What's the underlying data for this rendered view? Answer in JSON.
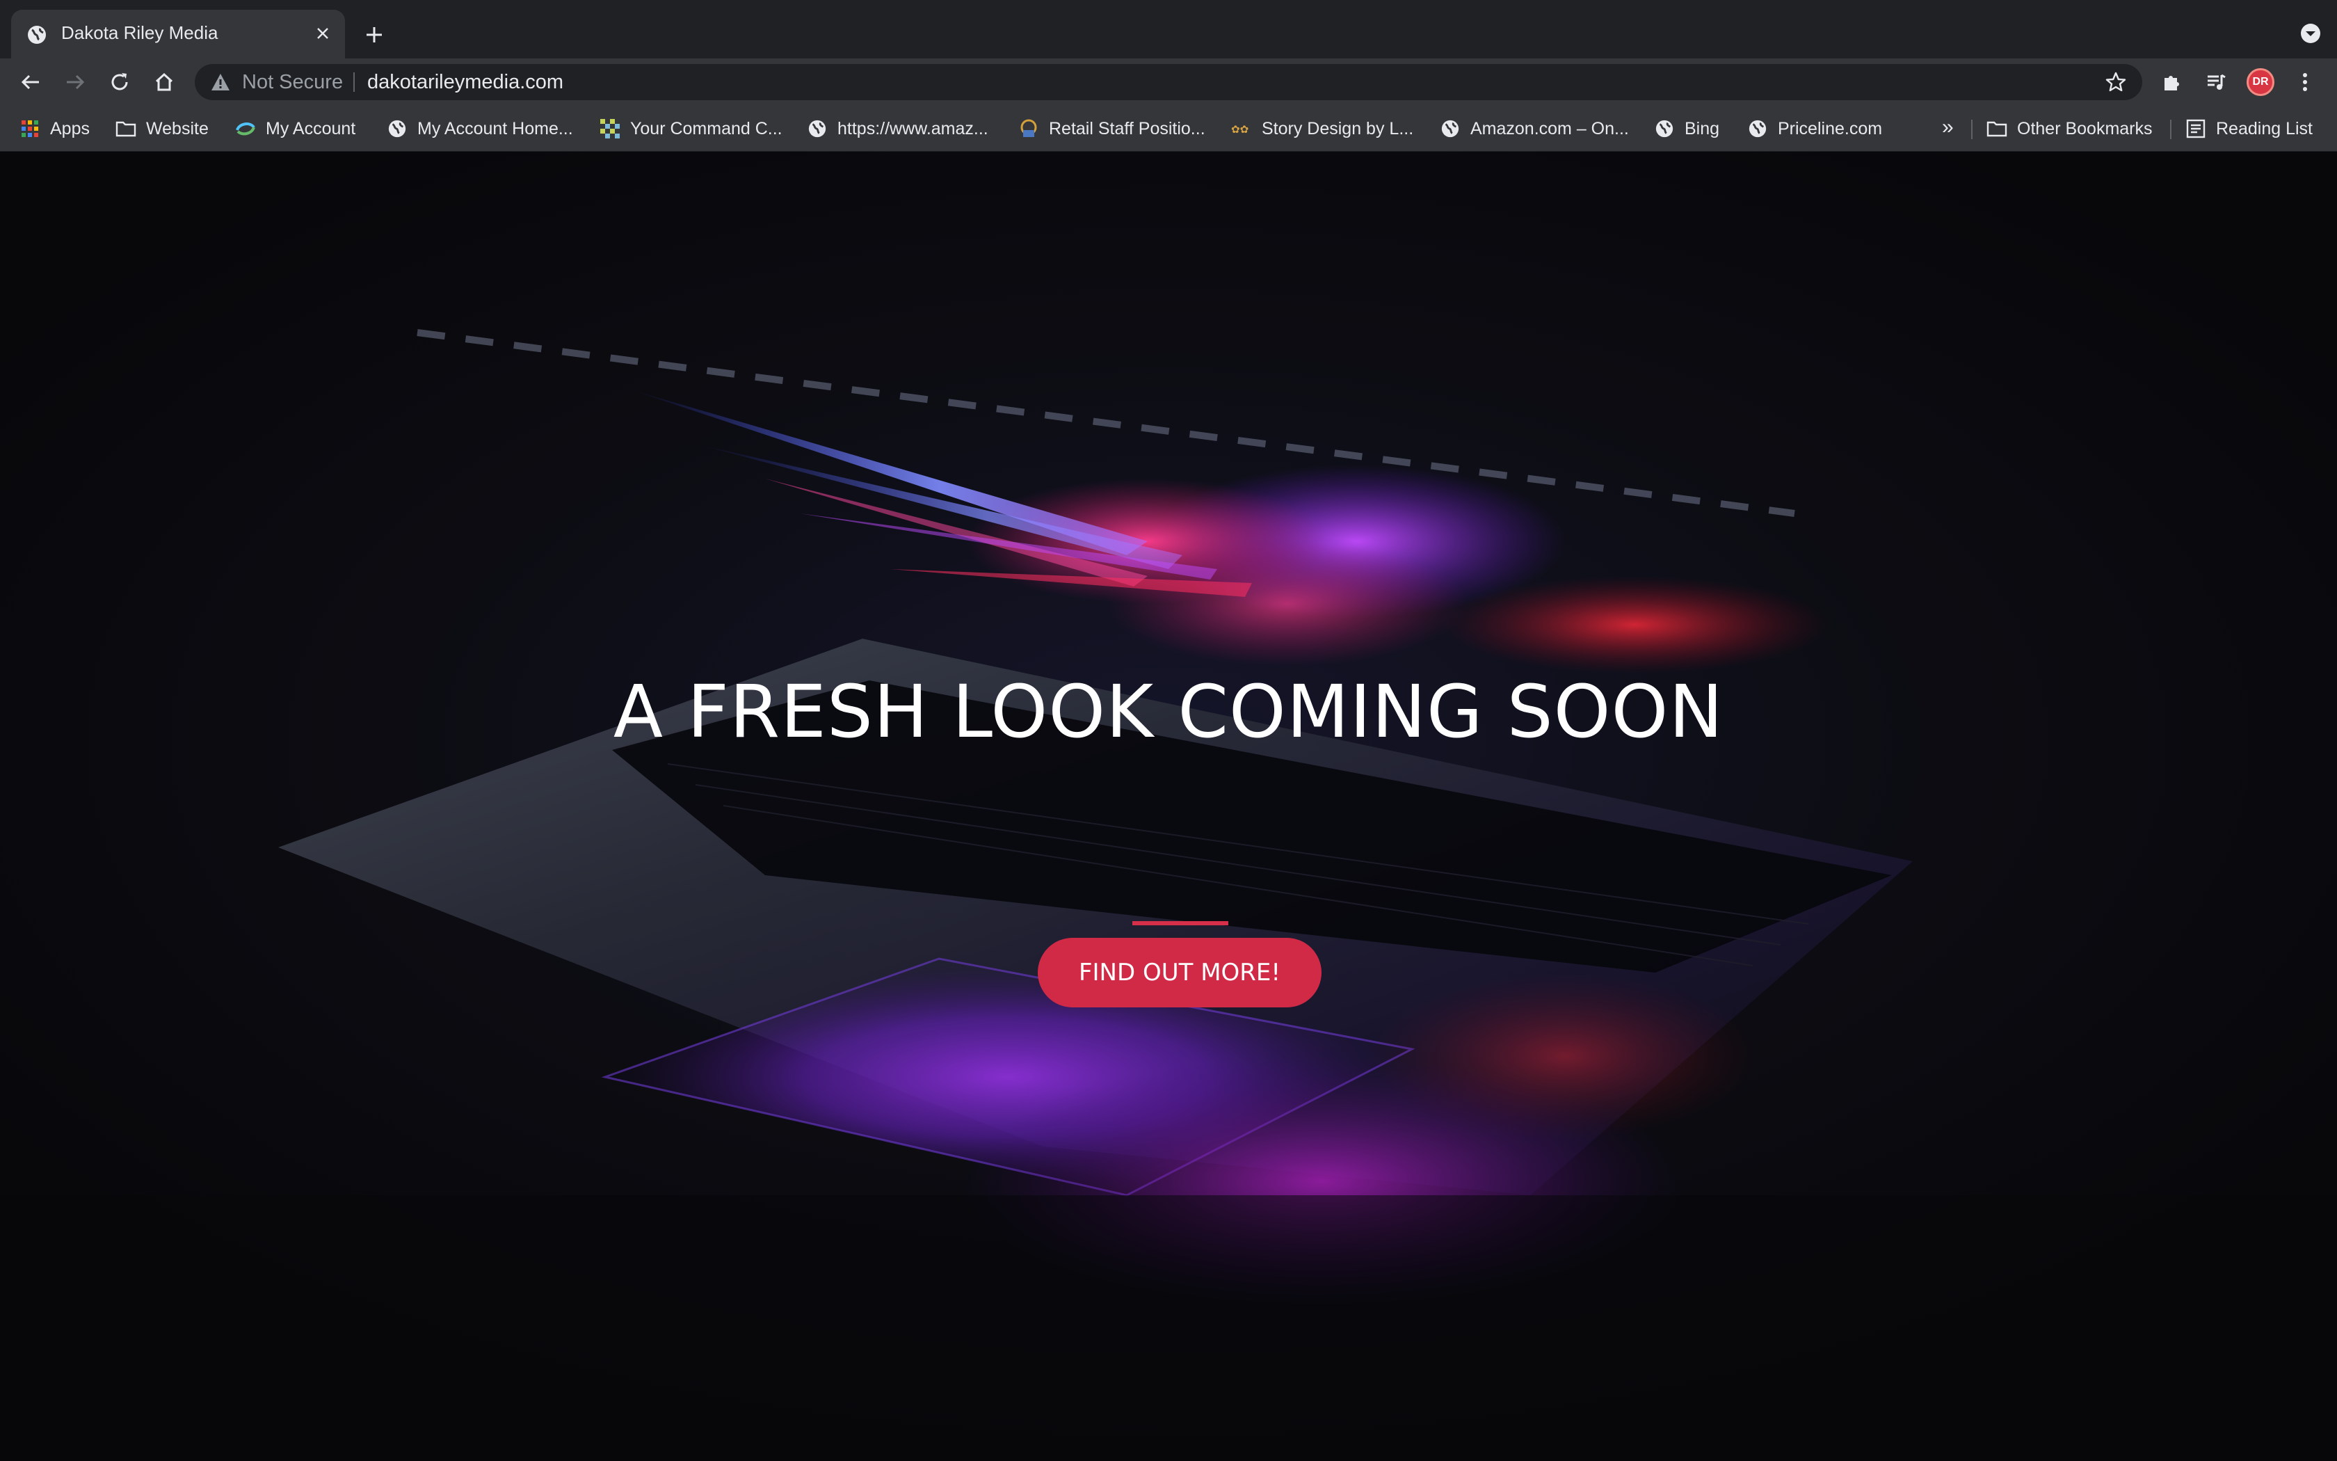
{
  "browser": {
    "tab": {
      "title": "Dakota Riley Media"
    },
    "omnibox": {
      "security_label": "Not Secure",
      "url": "dakotarileymedia.com"
    },
    "profile": {
      "initials": "DR"
    },
    "bookmarks": [
      {
        "label": "Apps",
        "icon": "apps-grid-icon"
      },
      {
        "label": "Website",
        "icon": "folder-icon"
      },
      {
        "label": "My Account",
        "icon": "account-swirl-icon"
      },
      {
        "label": "My Account Home...",
        "icon": "globe-icon"
      },
      {
        "label": "Your Command C...",
        "icon": "checker-icon"
      },
      {
        "label": "https://www.amaz...",
        "icon": "globe-icon"
      },
      {
        "label": "Retail Staff Positio...",
        "icon": "staff-icon"
      },
      {
        "label": "Story Design by L...",
        "icon": "story-icon"
      },
      {
        "label": "Amazon.com – On...",
        "icon": "globe-icon"
      },
      {
        "label": "Bing",
        "icon": "globe-icon"
      },
      {
        "label": "Priceline.com",
        "icon": "globe-icon"
      }
    ],
    "overflow_label": "»",
    "other_bookmarks": "Other Bookmarks",
    "reading_list": "Reading List"
  },
  "page": {
    "headline": "A FRESH LOOK COMING SOON",
    "cta_label": "FIND OUT MORE!"
  },
  "colors": {
    "accent": "#d12a47",
    "tab_bg": "#35363a",
    "chrome_bg": "#202124",
    "page_bg": "#0b0b0e"
  }
}
